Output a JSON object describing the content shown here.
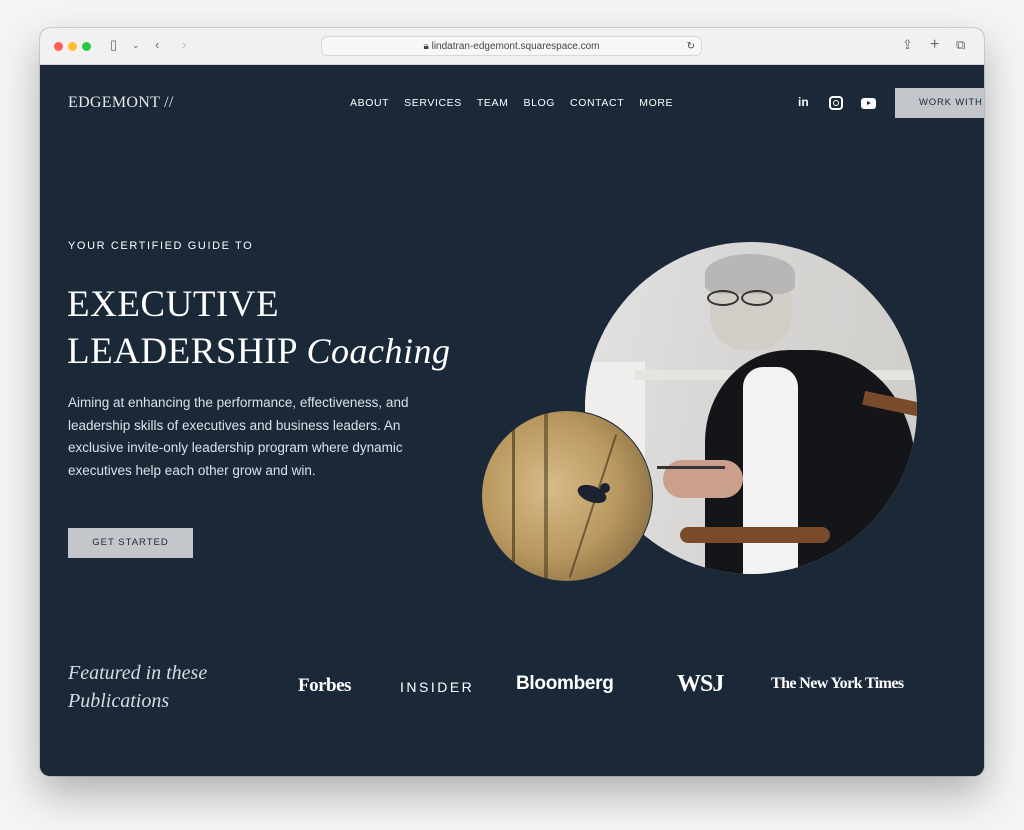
{
  "browser": {
    "url": "lindatran-edgemont.squarespace.com"
  },
  "header": {
    "logo": "EDGEMONT //",
    "nav": [
      "ABOUT",
      "SERVICES",
      "TEAM",
      "BLOG",
      "CONTACT",
      "MORE"
    ],
    "social": [
      "linkedin-icon",
      "instagram-icon",
      "youtube-icon"
    ],
    "cta": "WORK WITH"
  },
  "hero": {
    "eyebrow": "YOUR CERTIFIED GUIDE TO",
    "title_line1": "EXECUTIVE",
    "title_line2": "LEADERSHIP",
    "title_italic": "Coaching",
    "description": "Aiming at enhancing the performance, effectiveness, and leadership skills of executives and business leaders. An exclusive invite-only leadership program where dynamic executives help each other grow and win.",
    "button": "GET STARTED"
  },
  "featured": {
    "heading_line1": "Featured in these",
    "heading_line2": "Publications",
    "publications": [
      "Forbes",
      "INSIDER",
      "Bloomberg",
      "WSJ",
      "The New York Times"
    ]
  },
  "colors": {
    "background": "#1a2838",
    "button": "#c3c6cb"
  }
}
